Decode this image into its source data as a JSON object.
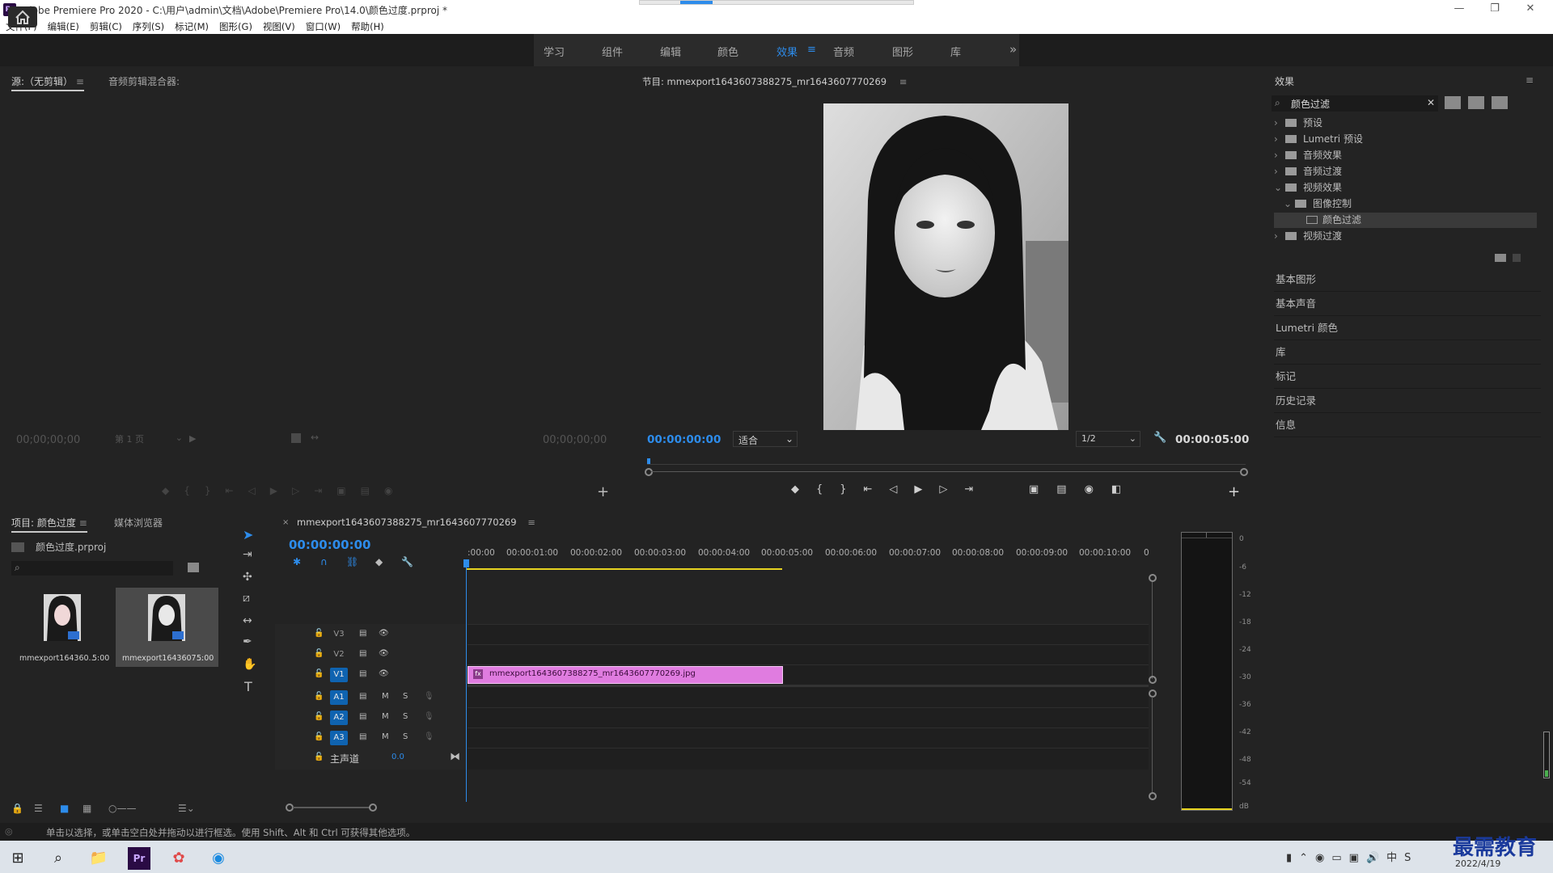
{
  "window": {
    "title": "Adobe Premiere Pro 2020 - C:\\用户\\admin\\文档\\Adobe\\Premiere Pro\\14.0\\颜色过度.prproj *",
    "app_icon": "Pr",
    "minimize": "—",
    "restore": "❐",
    "close": "✕"
  },
  "menu": [
    "文件(F)",
    "编辑(E)",
    "剪辑(C)",
    "序列(S)",
    "标记(M)",
    "图形(G)",
    "视图(V)",
    "窗口(W)",
    "帮助(H)"
  ],
  "workspaces": {
    "tabs": [
      "学习",
      "组件",
      "编辑",
      "颜色",
      "效果",
      "音频",
      "图形",
      "库"
    ],
    "active": "效果",
    "more": "»"
  },
  "source_panel": {
    "tab_active": "源:（无剪辑）",
    "tab_other": "音频剪辑混合器:",
    "timecode_left": "00;00;00;00",
    "page_select": "第 1 页",
    "timecode_right": "00;00;00;00"
  },
  "program_panel": {
    "title": "节目: mmexport1643607388275_mr1643607770269",
    "timecode": "00:00:00:00",
    "fit": "适合",
    "resolution": "1/2",
    "duration": "00:00:05:00"
  },
  "effects_panel": {
    "title": "效果",
    "search_value": "颜色过滤",
    "tree": [
      {
        "label": "预设",
        "level": 0,
        "expanded": false
      },
      {
        "label": "Lumetri 预设",
        "level": 0,
        "expanded": false
      },
      {
        "label": "音频效果",
        "level": 0,
        "expanded": false
      },
      {
        "label": "音频过渡",
        "level": 0,
        "expanded": false
      },
      {
        "label": "视频效果",
        "level": 0,
        "expanded": true
      },
      {
        "label": "图像控制",
        "level": 1,
        "expanded": true
      },
      {
        "label": "颜色过滤",
        "level": 2,
        "expanded": false
      },
      {
        "label": "视频过渡",
        "level": 0,
        "expanded": false
      }
    ],
    "side_panels": [
      "基本图形",
      "基本声音",
      "Lumetri 颜色",
      "库",
      "标记",
      "历史记录",
      "信息"
    ]
  },
  "project_panel": {
    "tab_active": "项目: 颜色过度",
    "tab_other": "媒体浏览器",
    "project_file": "颜色过度.prproj",
    "items": [
      {
        "name": "mmexport164360...",
        "duration": "5:00"
      },
      {
        "name": "mmexport1643607...",
        "duration": "5:00"
      }
    ]
  },
  "timeline": {
    "sequence_name": "mmexport1643607388275_mr1643607770269",
    "timecode": "00:00:00:00",
    "ruler": [
      ":00:00",
      "00:00:01:00",
      "00:00:02:00",
      "00:00:03:00",
      "00:00:04:00",
      "00:00:05:00",
      "00:00:06:00",
      "00:00:07:00",
      "00:00:08:00",
      "00:00:09:00",
      "00:00:10:00",
      "0"
    ],
    "video_tracks": [
      "V3",
      "V2",
      "V1"
    ],
    "audio_tracks": [
      "A1",
      "A2",
      "A3"
    ],
    "master_label": "主声道",
    "master_value": "0.0",
    "clip_name": "mmexport1643607388275_mr1643607770269.jpg",
    "clip_fx": "fx",
    "clip_duration_seconds": 5
  },
  "audio_meter": {
    "labels": [
      "0",
      "-6",
      "-12",
      "-18",
      "-24",
      "-30",
      "-36",
      "-42",
      "-48",
      "-54",
      "dB"
    ]
  },
  "status_bar": {
    "text": "单击以选择，或单击空白处并拖动以进行框选。使用 Shift、Alt 和 Ctrl 可获得其他选项。"
  },
  "taskbar": {
    "date": "2022/4/19",
    "watermark": "最需教育"
  },
  "colors": {
    "accent": "#2d8ceb",
    "clip": "#e07ce0",
    "selection": "#0f63b0"
  }
}
